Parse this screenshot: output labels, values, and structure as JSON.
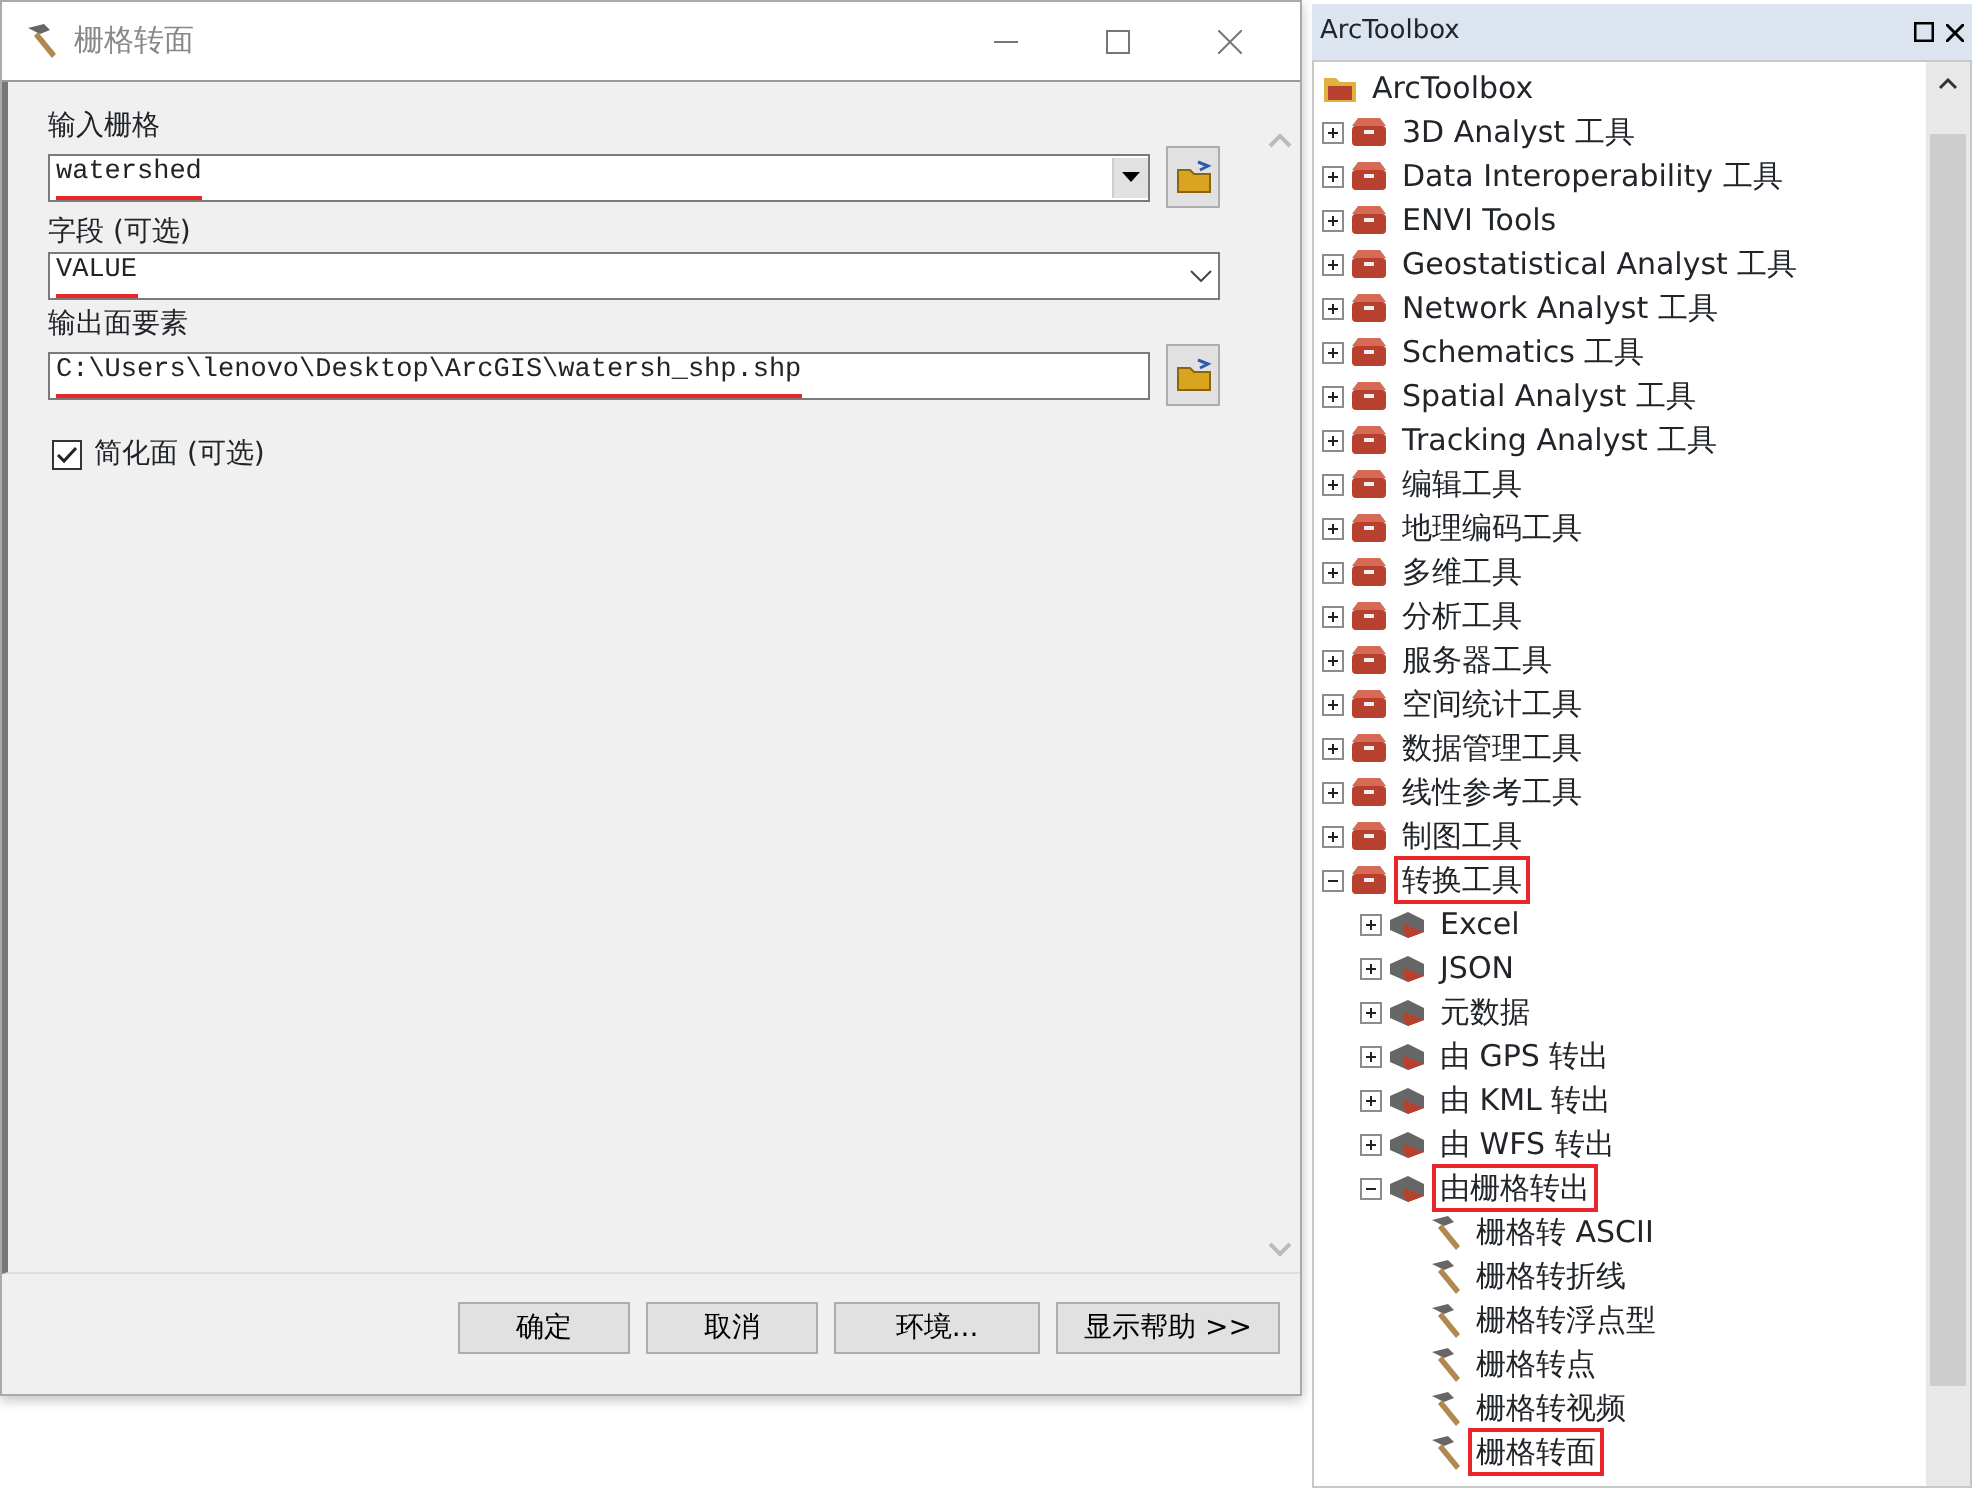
{
  "dialog": {
    "title": "栅格转面",
    "fields": [
      {
        "kind": "combo",
        "label": "输入栅格",
        "value": "watershed",
        "underlined": true
      },
      {
        "kind": "dropdown",
        "label": "字段 (可选)",
        "value": "VALUE",
        "underlined": true
      },
      {
        "kind": "path",
        "label": "输出面要素",
        "value": "C:\\Users\\lenovo\\Desktop\\ArcGIS\\watersh_shp.shp",
        "underlined": true
      }
    ],
    "checkbox": {
      "label": "简化面 (可选)",
      "checked": true
    },
    "buttons": [
      "确定",
      "取消",
      "环境...",
      "显示帮助 >>"
    ]
  },
  "toolbox": {
    "title": "ArcToolbox",
    "tree": [
      {
        "kind": "root",
        "label": "ArcToolbox",
        "highlighted": false,
        "children": [
          {
            "kind": "toolbox",
            "label": "3D Analyst 工具",
            "expanded": false,
            "highlighted": false
          },
          {
            "kind": "toolbox",
            "label": "Data Interoperability 工具",
            "expanded": false,
            "highlighted": false
          },
          {
            "kind": "toolbox",
            "label": "ENVI Tools",
            "expanded": false,
            "highlighted": false
          },
          {
            "kind": "toolbox",
            "label": "Geostatistical Analyst 工具",
            "expanded": false,
            "highlighted": false
          },
          {
            "kind": "toolbox",
            "label": "Network Analyst 工具",
            "expanded": false,
            "highlighted": false
          },
          {
            "kind": "toolbox",
            "label": "Schematics 工具",
            "expanded": false,
            "highlighted": false
          },
          {
            "kind": "toolbox",
            "label": "Spatial Analyst 工具",
            "expanded": false,
            "highlighted": false
          },
          {
            "kind": "toolbox",
            "label": "Tracking Analyst 工具",
            "expanded": false,
            "highlighted": false
          },
          {
            "kind": "toolbox",
            "label": "编辑工具",
            "expanded": false,
            "highlighted": false
          },
          {
            "kind": "toolbox",
            "label": "地理编码工具",
            "expanded": false,
            "highlighted": false
          },
          {
            "kind": "toolbox",
            "label": "多维工具",
            "expanded": false,
            "highlighted": false
          },
          {
            "kind": "toolbox",
            "label": "分析工具",
            "expanded": false,
            "highlighted": false
          },
          {
            "kind": "toolbox",
            "label": "服务器工具",
            "expanded": false,
            "highlighted": false
          },
          {
            "kind": "toolbox",
            "label": "空间统计工具",
            "expanded": false,
            "highlighted": false
          },
          {
            "kind": "toolbox",
            "label": "数据管理工具",
            "expanded": false,
            "highlighted": false
          },
          {
            "kind": "toolbox",
            "label": "线性参考工具",
            "expanded": false,
            "highlighted": false
          },
          {
            "kind": "toolbox",
            "label": "制图工具",
            "expanded": false,
            "highlighted": false
          },
          {
            "kind": "toolbox",
            "label": "转换工具",
            "expanded": true,
            "highlighted": true,
            "children": [
              {
                "kind": "toolset",
                "label": "Excel",
                "expanded": false,
                "highlighted": false
              },
              {
                "kind": "toolset",
                "label": "JSON",
                "expanded": false,
                "highlighted": false
              },
              {
                "kind": "toolset",
                "label": "元数据",
                "expanded": false,
                "highlighted": false
              },
              {
                "kind": "toolset",
                "label": "由 GPS 转出",
                "expanded": false,
                "highlighted": false
              },
              {
                "kind": "toolset",
                "label": "由 KML 转出",
                "expanded": false,
                "highlighted": false
              },
              {
                "kind": "toolset",
                "label": "由 WFS 转出",
                "expanded": false,
                "highlighted": false
              },
              {
                "kind": "toolset",
                "label": "由栅格转出",
                "expanded": true,
                "highlighted": true,
                "children": [
                  {
                    "kind": "tool",
                    "label": "栅格转 ASCII",
                    "highlighted": false
                  },
                  {
                    "kind": "tool",
                    "label": "栅格转折线",
                    "highlighted": false
                  },
                  {
                    "kind": "tool",
                    "label": "栅格转浮点型",
                    "highlighted": false
                  },
                  {
                    "kind": "tool",
                    "label": "栅格转点",
                    "highlighted": false
                  },
                  {
                    "kind": "tool",
                    "label": "栅格转视频",
                    "highlighted": false
                  },
                  {
                    "kind": "tool",
                    "label": "栅格转面",
                    "highlighted": true
                  }
                ]
              }
            ]
          }
        ]
      }
    ]
  }
}
